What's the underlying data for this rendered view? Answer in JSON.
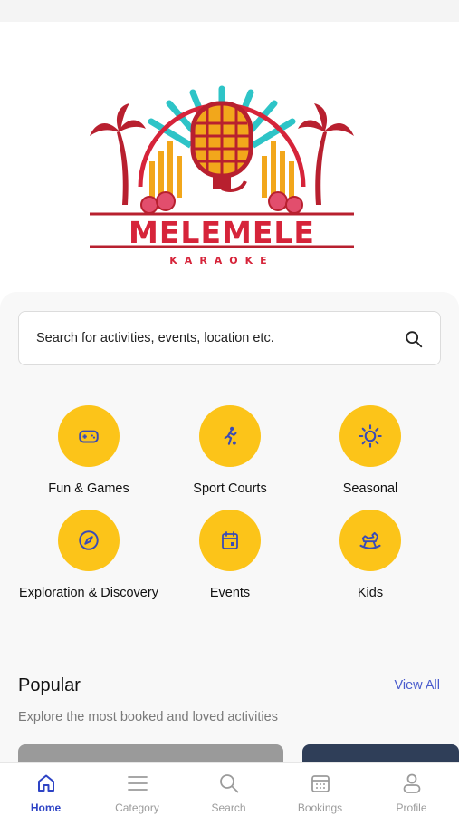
{
  "logo": {
    "brand": "MELEMELE",
    "tagline": "KARAOKE"
  },
  "search": {
    "placeholder": "Search for activities, events, location etc."
  },
  "categories": [
    {
      "label": "Fun & Games",
      "icon": "gamepad-icon"
    },
    {
      "label": "Sport Courts",
      "icon": "runner-icon"
    },
    {
      "label": "Seasonal",
      "icon": "sun-icon"
    },
    {
      "label": "Exploration & Discovery",
      "icon": "compass-icon"
    },
    {
      "label": "Events",
      "icon": "calendar-icon"
    },
    {
      "label": "Kids",
      "icon": "rocking-horse-icon"
    }
  ],
  "popular": {
    "title": "Popular",
    "view_all": "View All",
    "subtitle": "Explore the most booked and loved activities"
  },
  "nav": [
    {
      "label": "Home",
      "icon": "home-icon",
      "active": true
    },
    {
      "label": "Category",
      "icon": "menu-icon",
      "active": false
    },
    {
      "label": "Search",
      "icon": "search-icon",
      "active": false
    },
    {
      "label": "Bookings",
      "icon": "calendar-icon",
      "active": false
    },
    {
      "label": "Profile",
      "icon": "user-icon",
      "active": false
    }
  ],
  "colors": {
    "accent": "#fcc419",
    "icon": "#3a4bb5",
    "active_nav": "#2d43c5",
    "logo_red": "#d6243a",
    "logo_teal": "#2ec4c7"
  }
}
